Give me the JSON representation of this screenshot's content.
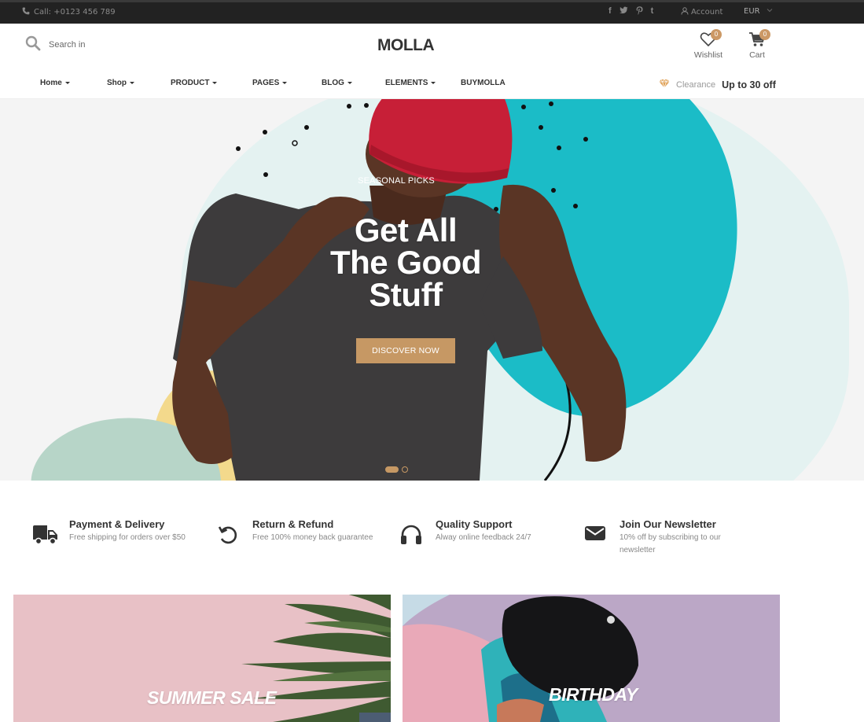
{
  "topbar": {
    "phone": "Call: +0123 456 789",
    "social_icons": [
      "facebook-icon",
      "twitter-icon",
      "pinterest-icon",
      "tumblr-icon"
    ],
    "account_label": "Account",
    "currency": "EUR"
  },
  "header": {
    "search_placeholder": "Search in",
    "logo": "MOLLA",
    "wishlist": {
      "label": "Wishlist",
      "count": "0"
    },
    "cart": {
      "label": "Cart",
      "count": "0"
    }
  },
  "nav": {
    "items": [
      {
        "label": "Home"
      },
      {
        "label": "Shop"
      },
      {
        "label": "PRODUCT"
      },
      {
        "label": "PAGES"
      },
      {
        "label": "BLOG"
      },
      {
        "label": "ELEMENTS"
      },
      {
        "label": "BUYMOLLA"
      }
    ],
    "clearance_label": "Clearance",
    "clearance_offer": "Up to 30 off"
  },
  "hero": {
    "subtitle": "SEASONAL PICKS",
    "title_line1": "Get All",
    "title_line2": "The Good",
    "title_line3": "Stuff",
    "cta_label": "DISCOVER NOW",
    "slide_count": 2,
    "active_slide": 1
  },
  "features": [
    {
      "icon": "truck-icon",
      "title": "Payment & Delivery",
      "desc": "Free shipping for orders over $50"
    },
    {
      "icon": "refund-icon",
      "title": "Return & Refund",
      "desc": "Free 100% money back guarantee"
    },
    {
      "icon": "headphones-icon",
      "title": "Quality Support",
      "desc": "Alway online feedback 24/7"
    },
    {
      "icon": "envelope-icon",
      "title": "Join Our Newsletter",
      "desc": "10% off by subscribing to our newsletter"
    }
  ],
  "banners": {
    "left_text": "SUMMER SALE",
    "right_text": "BIRTHDAY"
  },
  "colors": {
    "accent": "#c69864",
    "badge": "#cc9966",
    "topbar": "#222222",
    "teal": "#1bbcc7"
  }
}
